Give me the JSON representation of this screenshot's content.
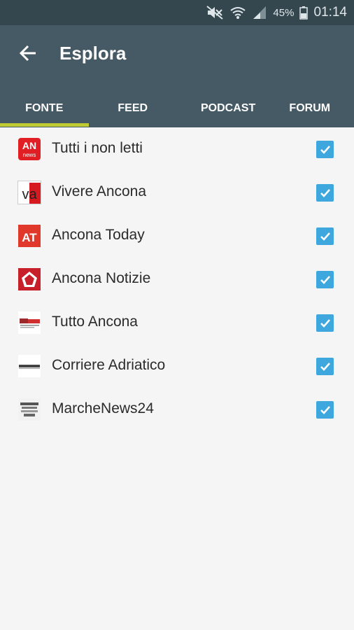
{
  "status_bar": {
    "battery": "45%",
    "time": "01:14"
  },
  "app_bar": {
    "title": "Esplora"
  },
  "tabs": [
    {
      "label": "FONTE",
      "selected": true
    },
    {
      "label": "FEED",
      "selected": false
    },
    {
      "label": "PODCAST",
      "selected": false
    },
    {
      "label": "FORUM",
      "selected": false
    }
  ],
  "sources": [
    {
      "label": "Tutti i non letti",
      "checked": true,
      "logo_text": "AN",
      "logo_subtext": "news"
    },
    {
      "label": "Vivere Ancona",
      "checked": true,
      "logo_text": "va"
    },
    {
      "label": "Ancona Today",
      "checked": true,
      "logo_text": "AT"
    },
    {
      "label": "Ancona Notizie",
      "checked": true
    },
    {
      "label": "Tutto Ancona",
      "checked": true
    },
    {
      "label": "Corriere Adriatico",
      "checked": true
    },
    {
      "label": "MarcheNews24",
      "checked": true
    }
  ],
  "colors": {
    "appbar": "#455a64",
    "statusbar": "#34474f",
    "indicator": "#c0ca33",
    "checkbox": "#3ea7de"
  }
}
